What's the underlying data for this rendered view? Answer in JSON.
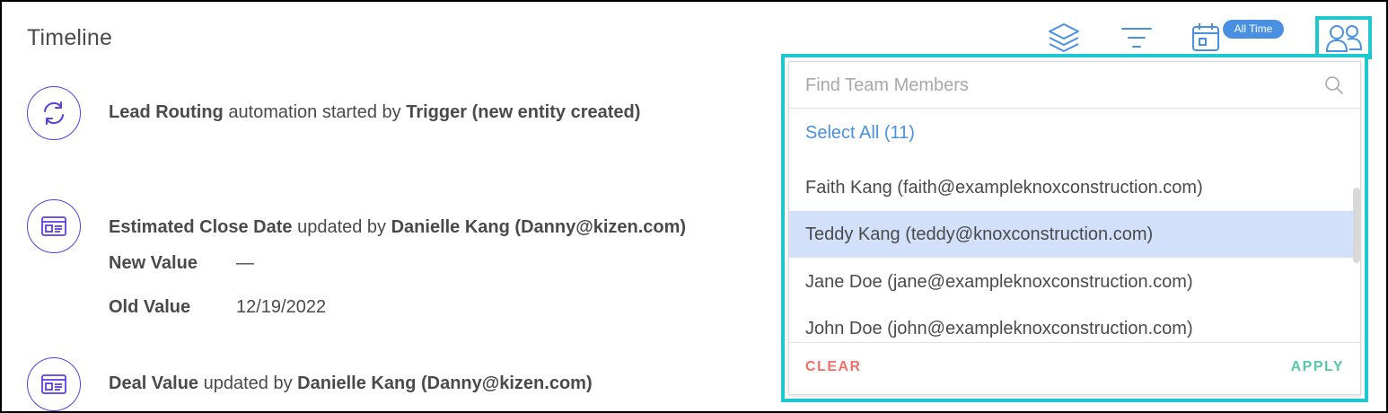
{
  "header": {
    "title": "Timeline",
    "date_filter_badge": "All Time"
  },
  "toolbar": {
    "icons": [
      "layers-icon",
      "filter-icon",
      "calendar-icon",
      "team-members-icon"
    ],
    "accent_color": "#4a90e2",
    "highlight_color": "#1fc7cf"
  },
  "events": [
    {
      "icon": "sync-icon",
      "subject": "Lead Routing",
      "action": " automation started by ",
      "actor": "Trigger (new entity created)"
    },
    {
      "icon": "id-card-icon",
      "subject": "Estimated Close Date",
      "action": " updated by ",
      "actor": "Danielle Kang (Danny@kizen.com)",
      "new_value_label": "New Value",
      "new_value": "—",
      "old_value_label": "Old Value",
      "old_value": "12/19/2022"
    },
    {
      "icon": "id-card-icon",
      "subject": "Deal Value",
      "action": " updated by ",
      "actor": "Danielle Kang (Danny@kizen.com)"
    }
  ],
  "team_dropdown": {
    "search_placeholder": "Find Team Members",
    "search_value": "",
    "select_all": "Select All (11)",
    "members": [
      "Faith Kang (faith@exampleknoxconstruction.com)",
      "Teddy Kang (teddy@knoxconstruction.com)",
      "Jane Doe (jane@exampleknoxconstruction.com)",
      "John Doe (john@exampleknoxconstruction.com)"
    ],
    "selected_member_index": 1,
    "clear_label": "CLEAR",
    "apply_label": "APPLY"
  }
}
